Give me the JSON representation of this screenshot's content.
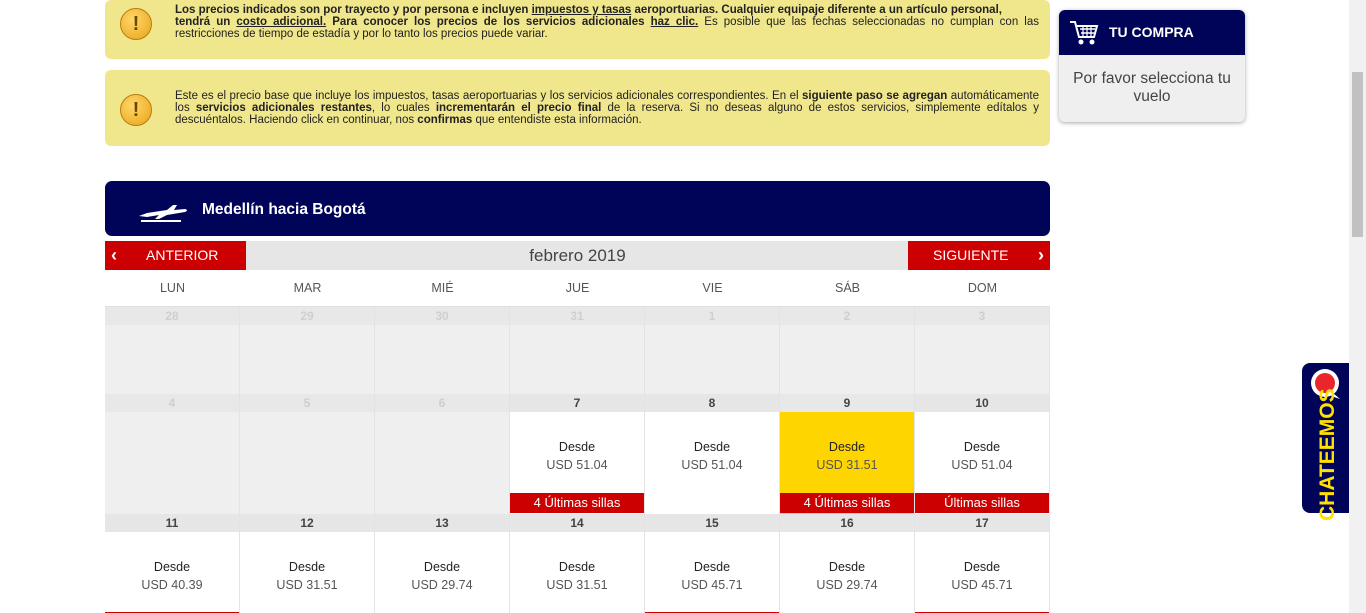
{
  "notices": {
    "first": {
      "p1": "Los precios indicados son por trayecto y por persona e incluyen ",
      "p2": "impuestos y tasas",
      "p3": " aeroportuarias. Cualquier equipaje diferente a un artículo personal,",
      "p4": " tendrá un ",
      "p5": "costo adicional.",
      "p6": " Para conocer los precios de los servicios adicionales ",
      "p7": "haz clic.",
      "p8": " Es posible que las fechas seleccionadas no cumplan con las restricciones de tiempo de estadía y por lo tanto los precios puede variar."
    },
    "second": {
      "p1": "Este es el precio base que incluye los impuestos, tasas aeroportuarias y los servicios adicionales correspondientes. En el ",
      "p2": "siguiente paso se agregan",
      "p3": " automáticamente los ",
      "p4": "servicios adicionales restantes",
      "p5": ", lo cuales ",
      "p6": "incrementarán el precio final",
      "p7": " de la reserva. Si no deseas alguno de estos servicios, simplemente edítalos y descuéntalos. Haciendo click en continuar, nos ",
      "p8": "confirmas",
      "p9": " que entendiste esta información."
    }
  },
  "route": {
    "title": "Medellín hacia Bogotá"
  },
  "calendar": {
    "prev_label": "ANTERIOR",
    "next_label": "SIGUIENTE",
    "month": "febrero 2019",
    "weekdays": [
      "LUN",
      "MAR",
      "MIÉ",
      "JUE",
      "VIE",
      "SÁB",
      "DOM"
    ],
    "rows": [
      [
        {
          "day": "28",
          "empty": true
        },
        {
          "day": "29",
          "empty": true
        },
        {
          "day": "30",
          "empty": true
        },
        {
          "day": "31",
          "empty": true
        },
        {
          "day": "1",
          "empty": true
        },
        {
          "day": "2",
          "empty": true
        },
        {
          "day": "3",
          "empty": true
        }
      ],
      [
        {
          "day": "4",
          "empty": true
        },
        {
          "day": "5",
          "empty": true
        },
        {
          "day": "6",
          "empty": true
        },
        {
          "day": "7",
          "desde": "Desde",
          "price": "USD 51.04",
          "badge": "4 Últimas sillas"
        },
        {
          "day": "8",
          "desde": "Desde",
          "price": "USD 51.04"
        },
        {
          "day": "9",
          "desde": "Desde",
          "price": "USD 31.51",
          "badge": "4 Últimas sillas",
          "selected": true
        },
        {
          "day": "10",
          "desde": "Desde",
          "price": "USD 51.04",
          "badge": "Últimas sillas"
        }
      ],
      [
        {
          "day": "11",
          "desde": "Desde",
          "price": "USD 40.39",
          "badge": "."
        },
        {
          "day": "12",
          "desde": "Desde",
          "price": "USD 31.51"
        },
        {
          "day": "13",
          "desde": "Desde",
          "price": "USD 29.74"
        },
        {
          "day": "14",
          "desde": "Desde",
          "price": "USD 31.51"
        },
        {
          "day": "15",
          "desde": "Desde",
          "price": "USD 45.71",
          "badge": "."
        },
        {
          "day": "16",
          "desde": "Desde",
          "price": "USD 29.74"
        },
        {
          "day": "17",
          "desde": "Desde",
          "price": "USD 45.71",
          "badge": "."
        }
      ]
    ]
  },
  "cart": {
    "title": "TU COMPRA",
    "message": "Por favor selecciona tu vuelo"
  },
  "chat": {
    "label": "CHATEEMOS"
  },
  "colors": {
    "navy": "#000459",
    "red": "#cc0000",
    "yellow": "#ffd500",
    "notice": "#f0e68c"
  }
}
